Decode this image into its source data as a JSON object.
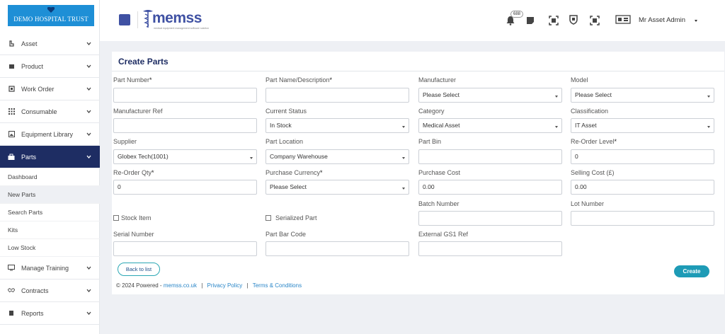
{
  "brand": {
    "name": "DEMO HOSPITAL TRUST"
  },
  "sidebar": {
    "items": [
      {
        "label": "Asset",
        "icon": "asset-icon"
      },
      {
        "label": "Product",
        "icon": "product-icon"
      },
      {
        "label": "Work Order",
        "icon": "work-order-icon"
      },
      {
        "label": "Consumable",
        "icon": "grid-icon"
      },
      {
        "label": "Equipment Library",
        "icon": "image-icon"
      },
      {
        "label": "Parts",
        "icon": "toolbox-icon",
        "active": true
      },
      {
        "label": "Manage Training",
        "icon": "monitor-icon"
      },
      {
        "label": "Contracts",
        "icon": "handshake-icon"
      },
      {
        "label": "Reports",
        "icon": "report-icon"
      }
    ],
    "parts_sub": [
      {
        "label": "Dashboard"
      },
      {
        "label": "New Parts",
        "selected": true
      },
      {
        "label": "Search Parts"
      },
      {
        "label": "Kits"
      },
      {
        "label": "Low Stock"
      }
    ]
  },
  "header": {
    "logo_text": "memss",
    "logo_tagline": "medical equipment management software solution",
    "notification_count": "688",
    "user_name": "Mr Asset Admin",
    "accent": "#3f51a3"
  },
  "form": {
    "title": "Create Parts",
    "fields": {
      "part_number": {
        "label": "Part Number",
        "value": ""
      },
      "part_name": {
        "label": "Part Name/Description",
        "value": ""
      },
      "manufacturer": {
        "label": "Manufacturer",
        "value": "Please Select"
      },
      "model": {
        "label": "Model",
        "value": "Please Select"
      },
      "manufacturer_ref": {
        "label": "Manufacturer Ref",
        "value": ""
      },
      "current_status": {
        "label": "Current Status",
        "value": "In Stock"
      },
      "category": {
        "label": "Category",
        "value": "Medical Asset"
      },
      "classification": {
        "label": "Classification",
        "value": "IT Asset"
      },
      "supplier": {
        "label": "Supplier",
        "value": "Globex Tech(1001)"
      },
      "part_location": {
        "label": "Part Location",
        "value": "Company Warehouse"
      },
      "part_bin": {
        "label": "Part Bin",
        "value": ""
      },
      "reorder_level": {
        "label": "Re-Order Level",
        "value": "0"
      },
      "reorder_qty": {
        "label": "Re-Order Qty",
        "value": "0"
      },
      "purchase_currency": {
        "label": "Purchase Currency",
        "value": "Please Select"
      },
      "purchase_cost": {
        "label": "Purchase Cost",
        "value": "0.00"
      },
      "selling_cost": {
        "label": "Selling Cost (£)",
        "value": "0.00"
      },
      "batch_number": {
        "label": "Batch Number",
        "value": ""
      },
      "lot_number": {
        "label": "Lot Number",
        "value": ""
      },
      "serial_number": {
        "label": "Serial Number",
        "value": ""
      },
      "part_bar_code": {
        "label": "Part Bar Code",
        "value": ""
      },
      "external_gs1_ref": {
        "label": "External GS1 Ref",
        "value": ""
      }
    },
    "stock_item_label": "Stock Item",
    "serialized_part_label": "Serialized Part",
    "required_marker": "*",
    "back_label": "Back to list",
    "create_label": "Create"
  },
  "footer": {
    "copyright": "© 2024 Powered -",
    "site_link": "memss.co.uk",
    "privacy": "Privacy Policy",
    "terms": "Terms & Conditions",
    "separator": "|"
  }
}
